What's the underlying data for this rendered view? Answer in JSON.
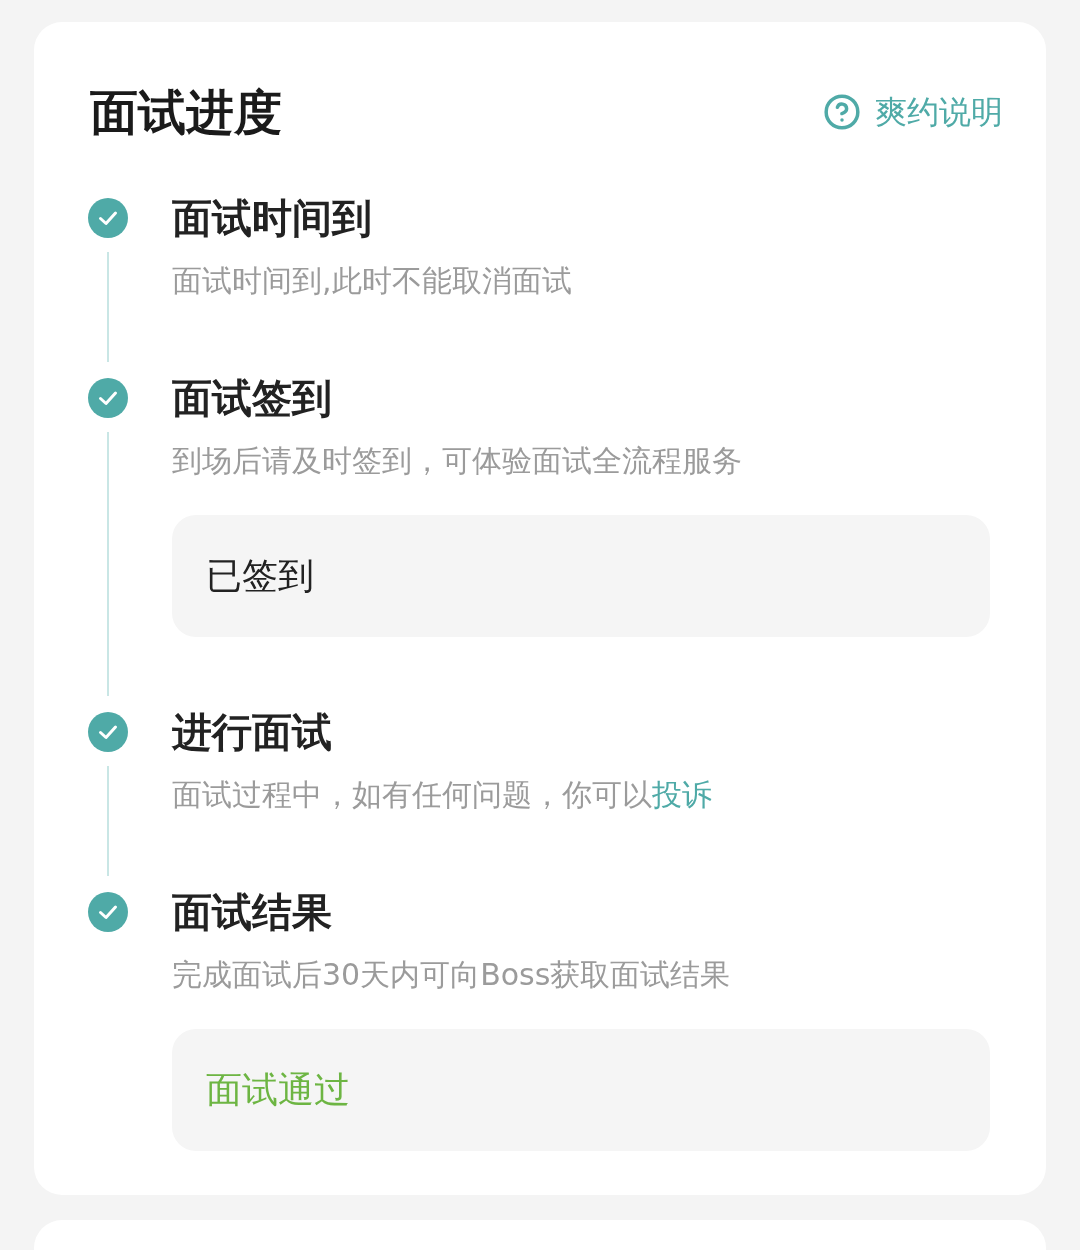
{
  "header": {
    "title": "面试进度",
    "help_link": "爽约说明"
  },
  "steps": [
    {
      "title": "面试时间到",
      "description": "面试时间到,此时不能取消面试",
      "done": true
    },
    {
      "title": "面试签到",
      "description": "到场后请及时签到，可体验面试全流程服务",
      "done": true,
      "result": {
        "text": "已签到",
        "kind": "neutral"
      }
    },
    {
      "title": "进行面试",
      "description": "面试过程中，如有任何问题，你可以",
      "link": "投诉",
      "done": true
    },
    {
      "title": "面试结果",
      "description": "完成面试后30天内可向Boss获取面试结果",
      "done": true,
      "result": {
        "text": "面试通过",
        "kind": "success"
      }
    }
  ]
}
